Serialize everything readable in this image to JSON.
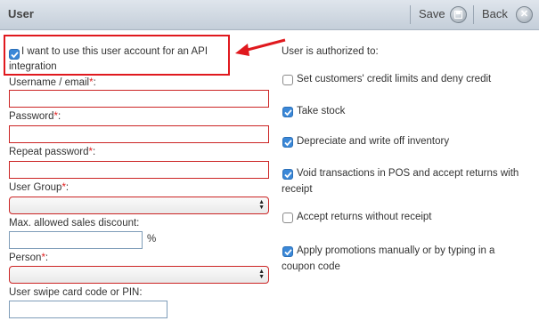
{
  "header": {
    "title": "User",
    "save_label": "Save",
    "back_label": "Back",
    "save_icon": "save-disk-icon",
    "back_icon": "close-icon"
  },
  "api": {
    "checked": true,
    "label_line1": "I want to use this user account for an API",
    "label_line2": "integration"
  },
  "form": {
    "username_label": "Username / email",
    "password_label": "Password",
    "repeat_password_label": "Repeat password",
    "user_group_label": "User Group",
    "discount_label": "Max. allowed sales discount:",
    "discount_unit": "%",
    "person_label": "Person",
    "swipe_label": "User swipe card code or PIN:",
    "required_mark": "*",
    "colon": ":"
  },
  "permissions": {
    "heading": "User is authorized to:",
    "items": [
      {
        "line1": "Set customers' credit limits and deny credit",
        "line2": "",
        "checked": false
      },
      {
        "line1": "Take stock",
        "line2": "",
        "checked": true
      },
      {
        "line1": "Depreciate and write off inventory",
        "line2": "",
        "checked": true
      },
      {
        "line1": "Void transactions in POS and accept returns with",
        "line2": "receipt",
        "checked": true
      },
      {
        "line1": "Accept returns without receipt",
        "line2": "",
        "checked": false
      },
      {
        "line1": "Apply promotions manually or by typing in a",
        "line2": "coupon code",
        "checked": true
      }
    ]
  },
  "colors": {
    "header_bg": "#c4ced9",
    "required": "#e02020",
    "checkbox_on": "#3b88d8",
    "highlight": "#e0191e"
  }
}
